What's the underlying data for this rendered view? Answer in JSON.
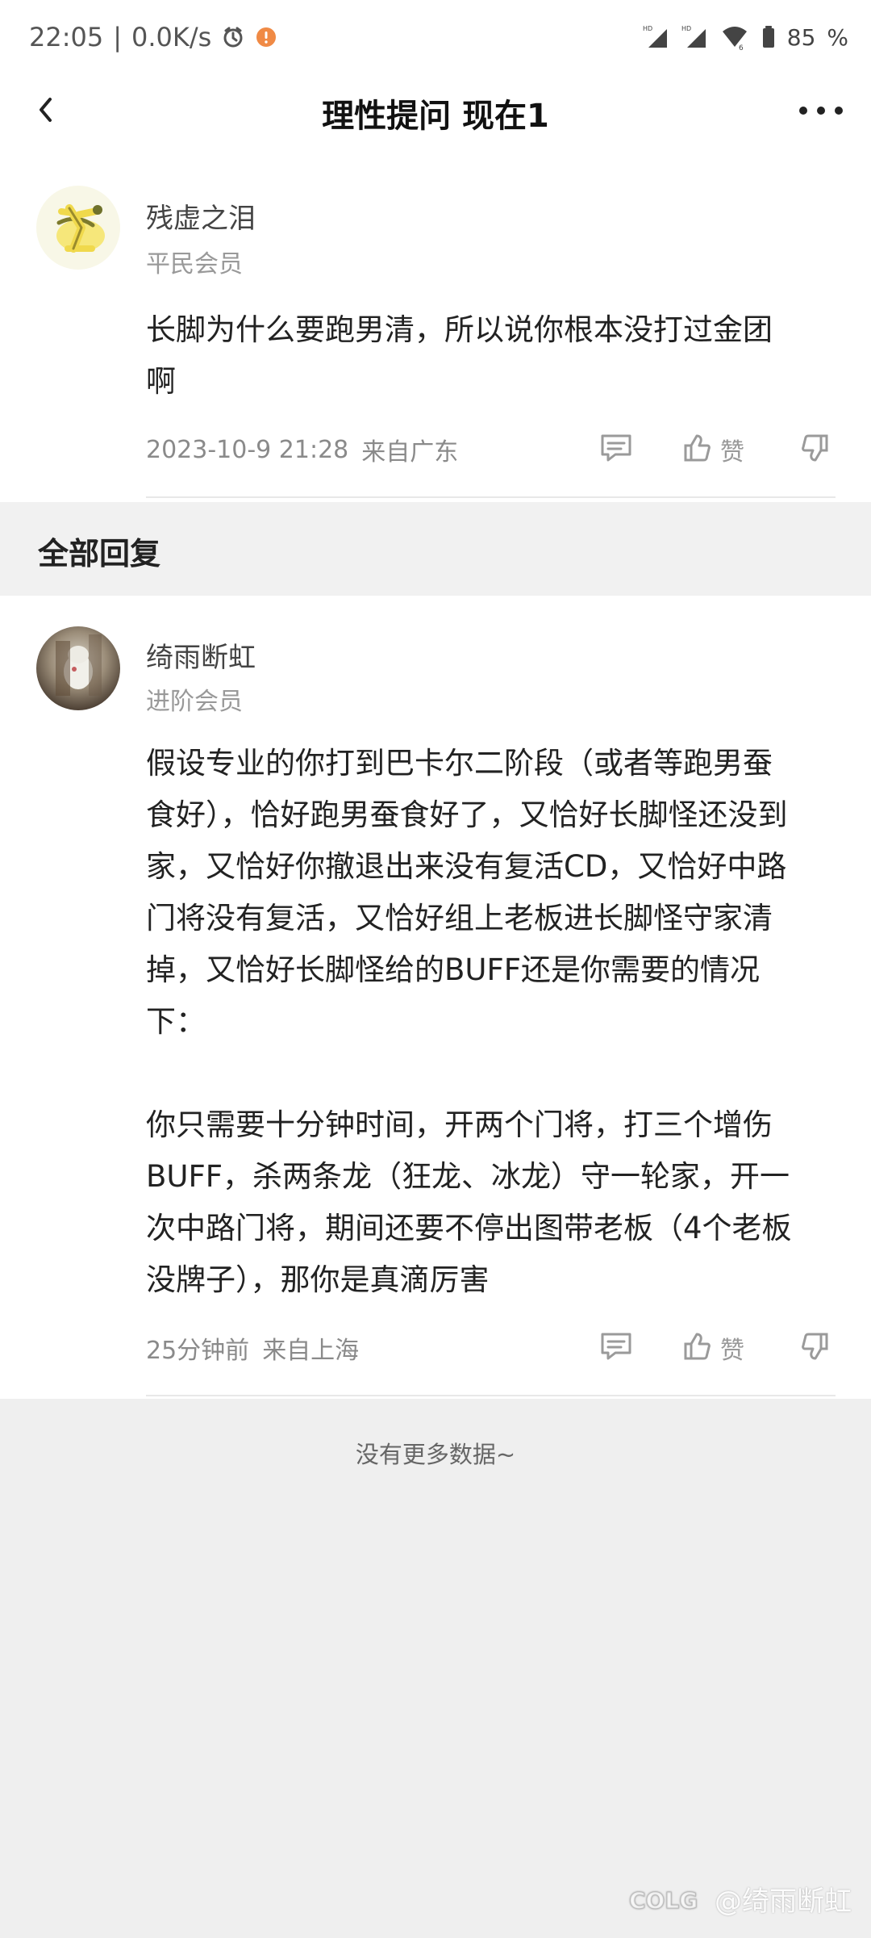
{
  "status_bar": {
    "time": "22:05",
    "divider": "|",
    "speed": "0.0K/s",
    "battery": "85",
    "percent_symbol": "%",
    "icons": [
      "alarm-icon",
      "notification-dot-icon",
      "hd-signal-icon",
      "wifi-icon",
      "battery-icon"
    ],
    "colors": {
      "notice_dot": "#f08a45"
    }
  },
  "header": {
    "title": "理性提问 现在1",
    "back_icon": "chevron-left-icon",
    "more_icon": "more-icon"
  },
  "post": {
    "user_name": "残虚之泪",
    "member_level": "平民会员",
    "content": "长脚为什么要跑男清，所以说你根本没打过金团\n啊",
    "timestamp": "2023-10-9 21:28",
    "location": "来自广东",
    "actions": {
      "like_label": "赞"
    }
  },
  "section": {
    "title": "全部回复"
  },
  "reply": {
    "user_name": "绮雨断虹",
    "member_level": "进阶会员",
    "content": "假设专业的你打到巴卡尔二阶段（或者等跑男蚕\n食好），恰好跑男蚕食好了，又恰好长脚怪还没到\n家，又恰好你撤退出来没有复活CD，又恰好中路\n门将没有复活，又恰好组上老板进长脚怪守家清\n掉，又恰好长脚怪给的BUFF还是你需要的情况\n下：\n\n你只需要十分钟时间，开两个门将，打三个增伤\nBUFF，杀两条龙（狂龙、冰龙）守一轮家，开一\n次中路门将，期间还要不停出图带老板（4个老板\n没牌子），那你是真滴厉害",
    "timestamp": "25分钟前",
    "location": "来自上海",
    "actions": {
      "like_label": "赞"
    }
  },
  "footer": {
    "empty_tip": "没有更多数据~"
  },
  "watermark": {
    "brand": "COLG",
    "text": "@绮雨断虹"
  },
  "colors": {
    "background": "#efefef",
    "white": "#ffffff",
    "text_primary": "#222222",
    "text_secondary": "#999999"
  }
}
